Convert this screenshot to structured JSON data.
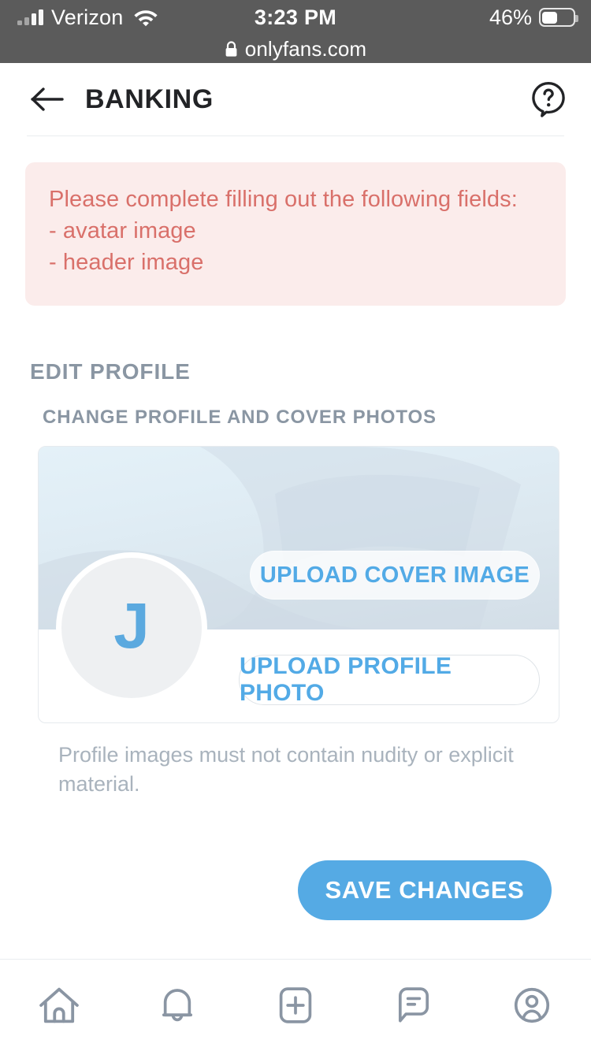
{
  "status_bar": {
    "carrier": "Verizon",
    "time": "3:23 PM",
    "battery_percent": "46%",
    "battery_level": 46,
    "domain": "onlyfans.com",
    "signal_bars": 4,
    "wifi": true
  },
  "header": {
    "title": "BANKING",
    "back_icon": "arrow-left-icon",
    "help_icon": "help-question-bubble-icon"
  },
  "alert": {
    "lines": [
      "Please complete filling out the following fields:",
      "- avatar image",
      "- header image"
    ],
    "bg_color": "#fbeceb",
    "text_color": "#d9706a"
  },
  "section": {
    "title": "EDIT PROFILE",
    "subtitle": "CHANGE PROFILE AND COVER PHOTOS"
  },
  "profile_card": {
    "avatar_initial": "J",
    "avatar_text_color": "#5ba9df",
    "upload_cover_label": "UPLOAD COVER IMAGE",
    "upload_photo_label": "UPLOAD PROFILE PHOTO",
    "link_color": "#52aae6"
  },
  "note": "Profile images must not contain nudity or explicit material.",
  "save": {
    "label": "SAVE CHANGES",
    "color": "#55aae4"
  },
  "bottom_nav": {
    "items": [
      {
        "name": "home-icon",
        "label": "Home"
      },
      {
        "name": "bell-icon",
        "label": "Notifications"
      },
      {
        "name": "add-post-icon",
        "label": "New Post"
      },
      {
        "name": "messages-icon",
        "label": "Messages"
      },
      {
        "name": "profile-icon",
        "label": "Profile"
      }
    ],
    "icon_color": "#8a95a3"
  }
}
